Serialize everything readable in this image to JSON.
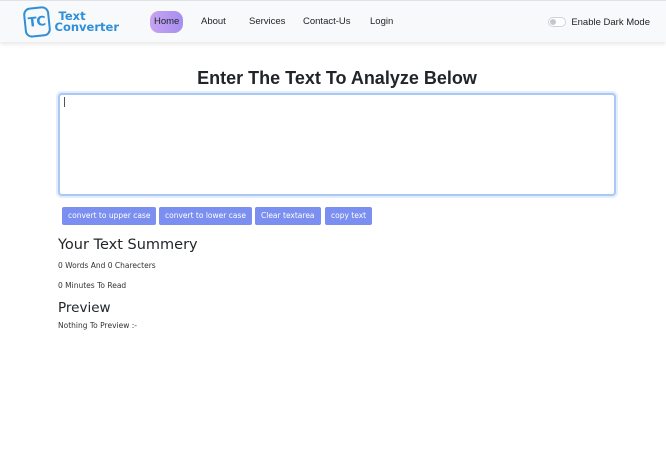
{
  "navbar": {
    "brand": {
      "badge": "TC",
      "line1": "Text",
      "line2": "Converter"
    },
    "links": [
      "Home",
      "About",
      "Services",
      "Contact-Us",
      "Login"
    ],
    "active_link": "Home",
    "dark_mode": {
      "label": "Enable Dark Mode",
      "enabled": false
    }
  },
  "main": {
    "heading": "Enter The Text To Analyze Below",
    "textarea_value": "",
    "buttons": [
      "convert to upper case",
      "convert to lower case",
      "Clear textarea",
      "copy text"
    ]
  },
  "summary": {
    "title": "Your Text Summery",
    "counts": "0 Words And 0 Charecters",
    "read_time": "0 Minutes To Read"
  },
  "preview": {
    "title": "Preview",
    "text": "Nothing To Preview :-"
  },
  "colors": {
    "brand": "#2f8fd8",
    "button": "#7b8ff0",
    "active_nav": "#b89af0"
  },
  "icons": {
    "brand_logo": "tc-logo-icon",
    "dark_toggle": "toggle-switch-icon"
  }
}
